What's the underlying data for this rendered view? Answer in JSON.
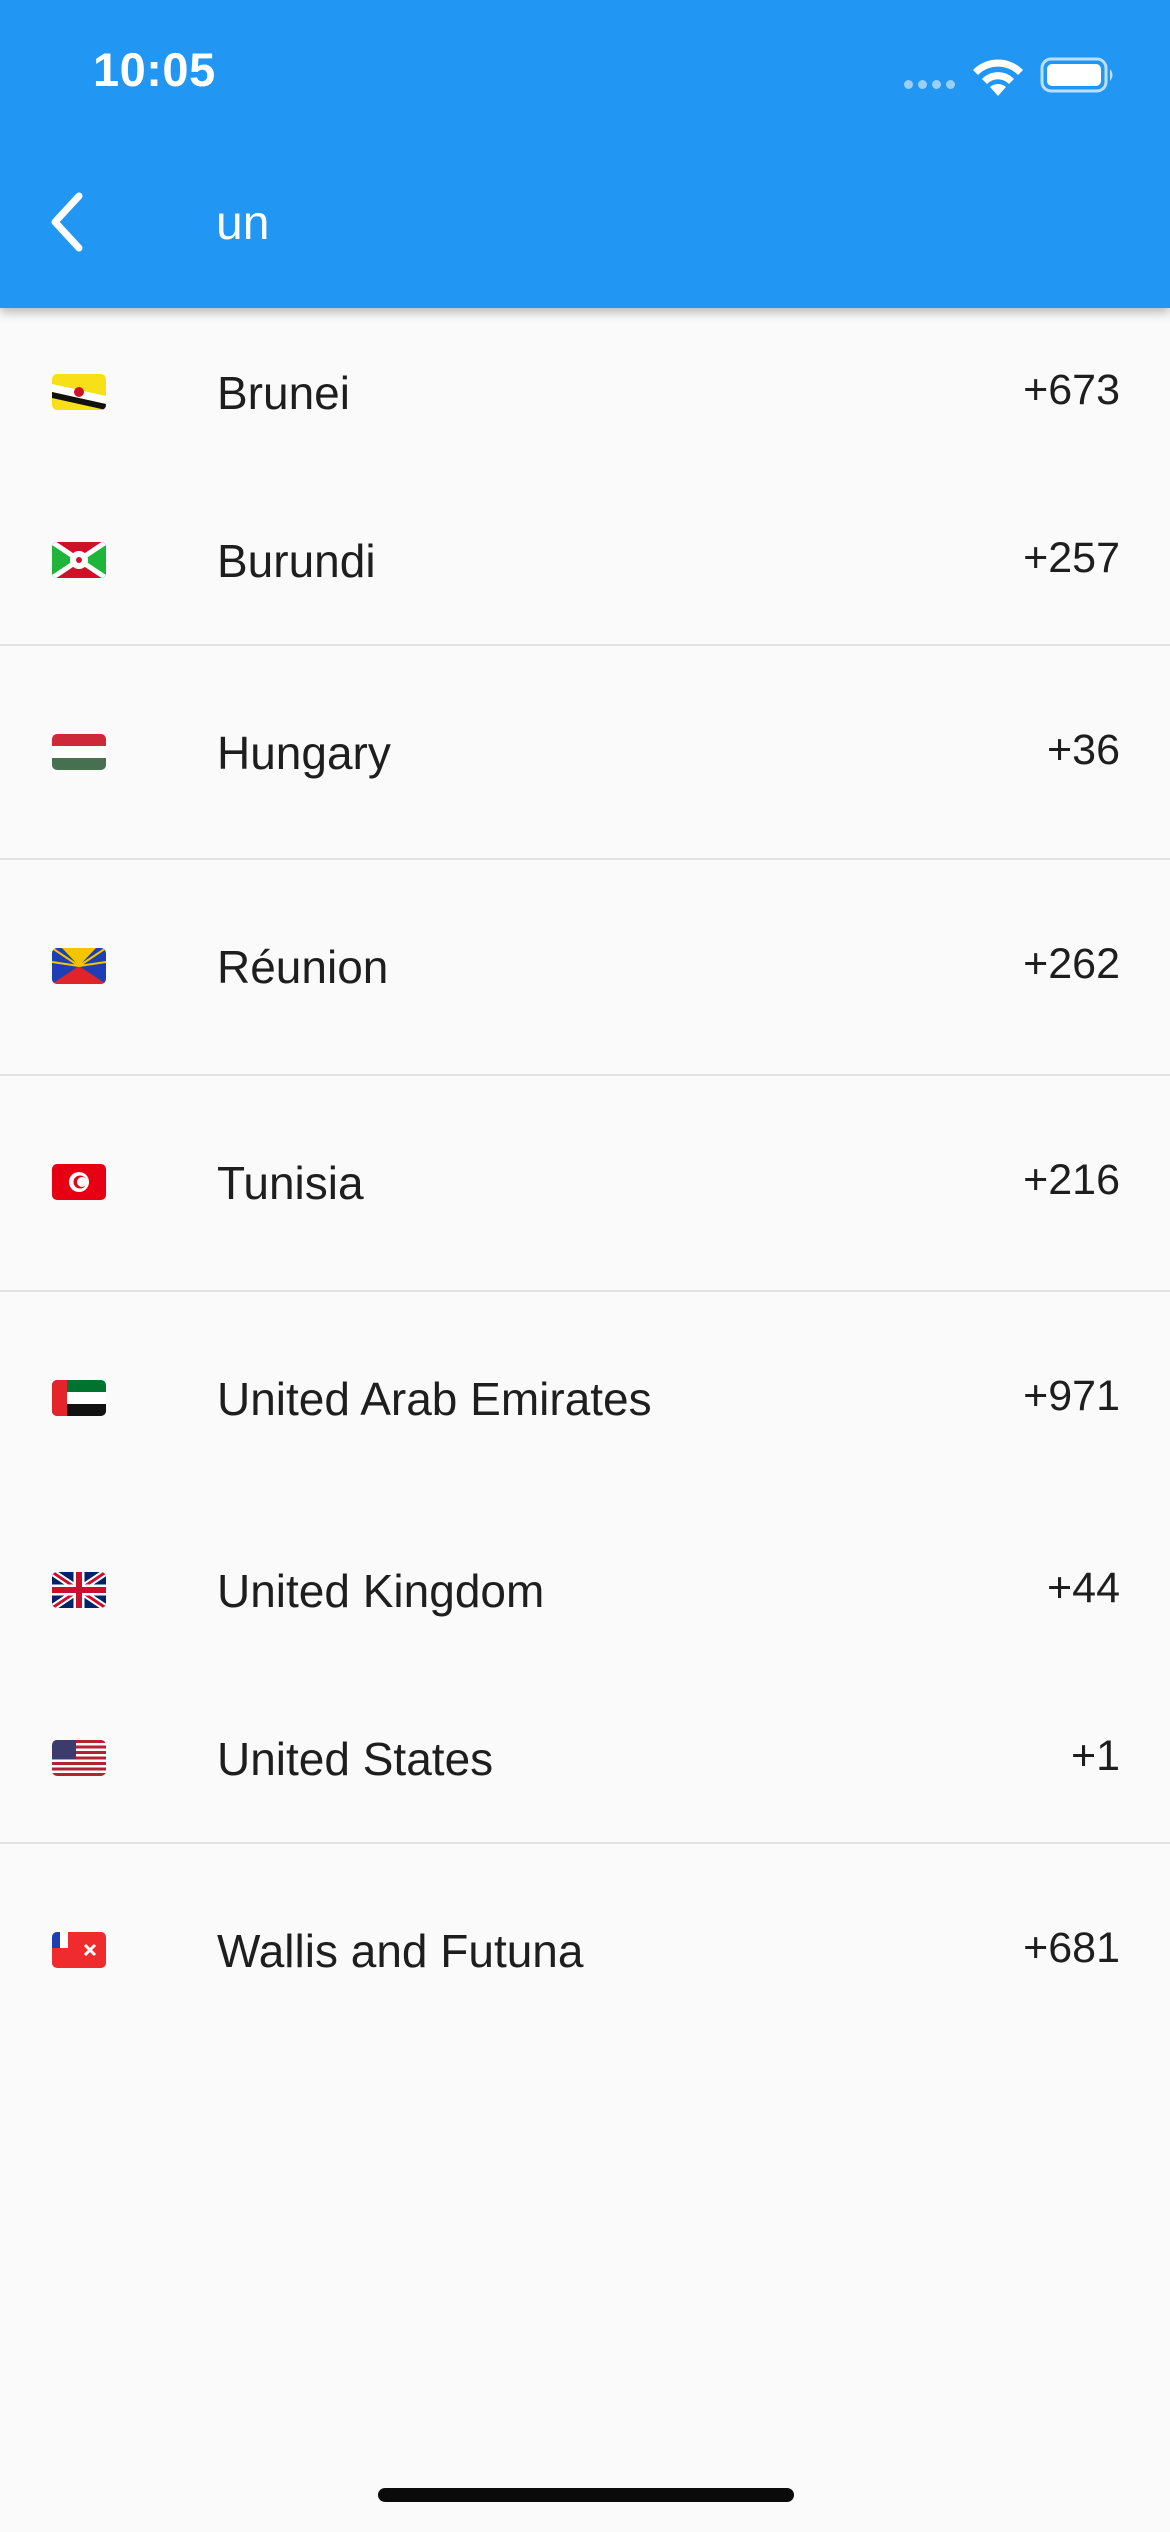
{
  "status_bar": {
    "time": "10:05"
  },
  "header": {
    "search_query": "un",
    "back_icon": "chevron-left-icon"
  },
  "colors": {
    "app_bar": "#2196f3",
    "background": "#fafafa",
    "divider": "#e3e3e3"
  },
  "groups": [
    {
      "items": [
        {
          "name": "Brunei",
          "code": "+673",
          "flag": "flag-brunei-icon"
        },
        {
          "name": "Burundi",
          "code": "+257",
          "flag": "flag-burundi-icon"
        }
      ]
    },
    {
      "items": [
        {
          "name": "Hungary",
          "code": "+36",
          "flag": "flag-hungary-icon"
        }
      ]
    },
    {
      "items": [
        {
          "name": "Réunion",
          "code": "+262",
          "flag": "flag-reunion-icon"
        }
      ]
    },
    {
      "items": [
        {
          "name": "Tunisia",
          "code": "+216",
          "flag": "flag-tunisia-icon"
        }
      ]
    },
    {
      "items": [
        {
          "name": "United Arab Emirates",
          "code": "+971",
          "flag": "flag-uae-icon"
        },
        {
          "name": "United Kingdom",
          "code": "+44",
          "flag": "flag-uk-icon"
        },
        {
          "name": "United States",
          "code": "+1",
          "flag": "flag-us-icon"
        }
      ]
    },
    {
      "items": [
        {
          "name": "Wallis and Futuna",
          "code": "+681",
          "flag": "flag-wallis-futuna-icon"
        }
      ]
    }
  ]
}
